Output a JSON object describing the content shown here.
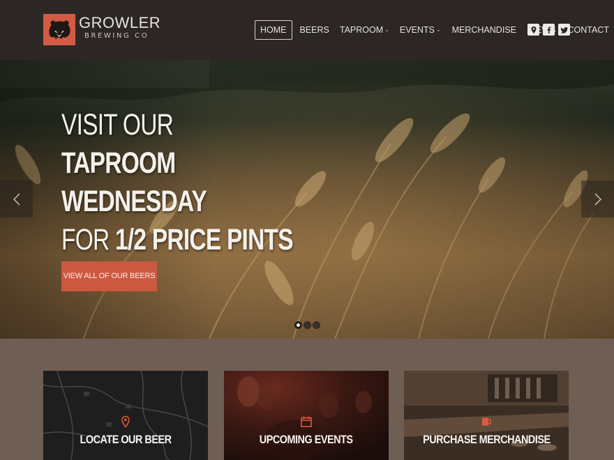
{
  "brand": {
    "name": "GROWLER",
    "subtitle": "BREWING CO"
  },
  "nav": {
    "home": "HOME",
    "beers": "BEERS",
    "taproom": "TAPROOM",
    "events": "EVENTS",
    "merchandise": "MERCHANDISE",
    "news": "NEWS",
    "contact": "CONTACT",
    "caret": "⌄"
  },
  "social": [
    "map-pin-icon",
    "facebook-icon",
    "twitter-icon"
  ],
  "hero": {
    "line1": "VISIT OUR",
    "line2": "TAPROOM",
    "line3": "WEDNESDAY",
    "line4_pre": "FOR ",
    "line4_bold": "1/2 PRICE PINTS",
    "cta": "VIEW ALL OF OUR BEERS",
    "slides": 3,
    "active_slide": 1
  },
  "cards": [
    {
      "title": "LOCATE OUR BEER",
      "icon": "map-pin-icon"
    },
    {
      "title": "UPCOMING EVENTS",
      "icon": "calendar-icon"
    },
    {
      "title": "PURCHASE MERCHANDISE",
      "icon": "mug-icon"
    }
  ],
  "colors": {
    "header": "#2c2724",
    "accent": "#cd5840",
    "band": "#6e5e53"
  }
}
